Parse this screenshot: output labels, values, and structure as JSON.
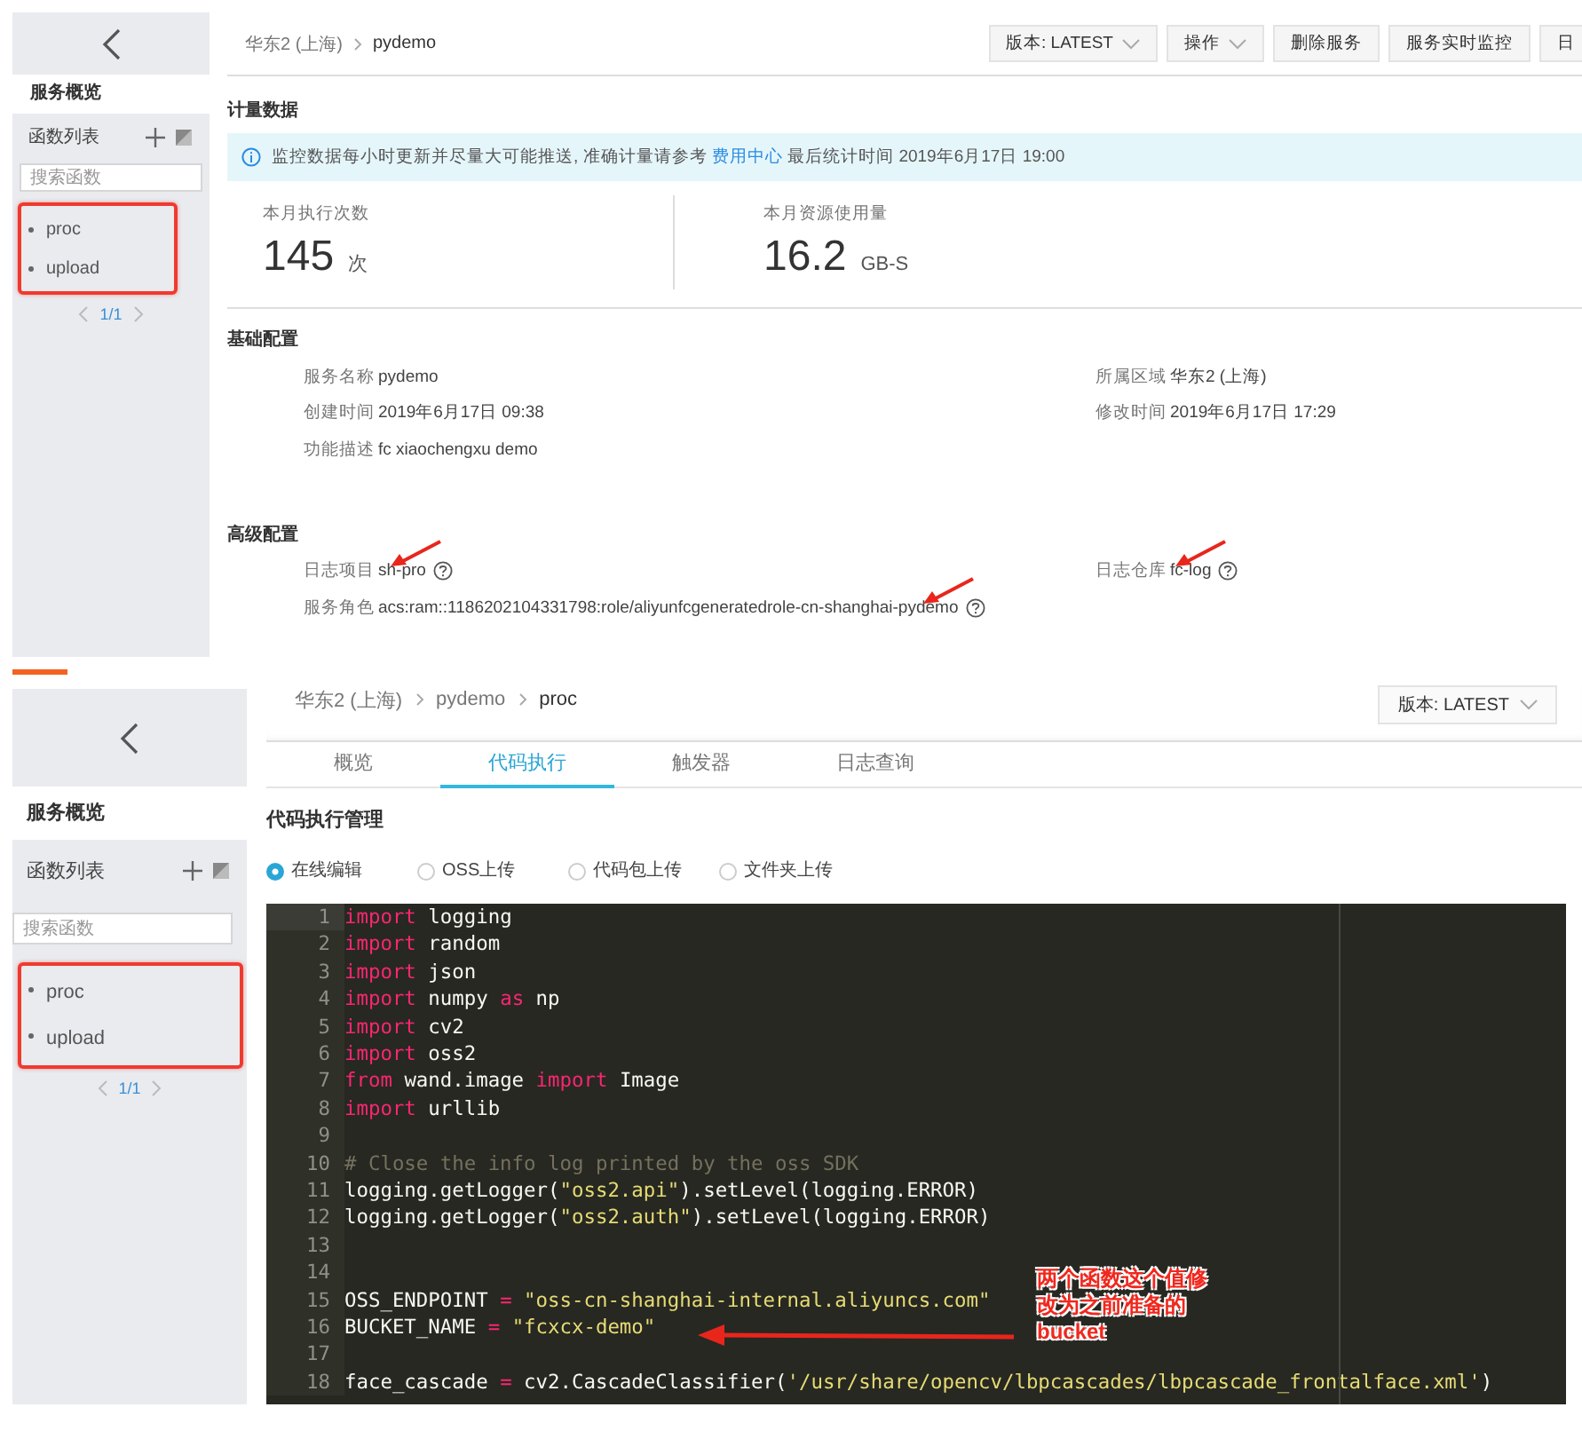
{
  "service_page": {
    "sidebar": {
      "title": "服务概览",
      "list_title": "函数列表",
      "search": {
        "placeholder": "搜索函数"
      },
      "highlighted": true,
      "functions": [
        {
          "name": "proc",
          "selected": false
        },
        {
          "name": "upload",
          "selected": false
        }
      ],
      "pagination": "1/1"
    },
    "breadcrumb": [
      "华东2 (上海)",
      "pydemo"
    ],
    "actions": [
      {
        "label": "版本: LATEST",
        "dropdown": true
      },
      {
        "label": "操作",
        "dropdown": true
      },
      {
        "label": "删除服务",
        "dropdown": false
      },
      {
        "label": "服务实时监控",
        "dropdown": false
      },
      {
        "label": "日",
        "dropdown": false
      }
    ],
    "metering": {
      "title": "计量数据",
      "notice": {
        "text": "监控数据每小时更新并尽量大可能推送, 准确计量请参考",
        "link": "费用中心",
        "text_after": "最后统计时间 2019年6月17日 19:00"
      },
      "stats": [
        {
          "label": "本月执行次数",
          "value": "145",
          "unit": "次"
        },
        {
          "label": "本月资源使用量",
          "value": "16.2",
          "unit": "GB-S"
        }
      ]
    },
    "basic": {
      "title": "基础配置",
      "left": [
        {
          "label": "服务名称",
          "value": "pydemo",
          "help": false,
          "arrow": false
        },
        {
          "label": "创建时间",
          "value": "2019年6月17日 09:38",
          "help": false,
          "arrow": false
        },
        {
          "label": "功能描述",
          "value": "fc xiaochengxu demo",
          "help": false,
          "arrow": false
        }
      ],
      "right": [
        {
          "label": "所属区域",
          "value": "华东2 (上海)",
          "help": false,
          "arrow": false
        },
        {
          "label": "修改时间",
          "value": "2019年6月17日 17:29",
          "help": false,
          "arrow": false
        }
      ]
    },
    "advanced": {
      "title": "高级配置",
      "left": [
        {
          "label": "日志项目",
          "value": "sh-pro",
          "help": true,
          "arrow": true
        },
        {
          "label": "服务角色",
          "value": "acs:ram::1186202104331798:role/aliyunfcgeneratedrole-cn-shanghai-pydemo",
          "help": true,
          "arrow": true
        }
      ],
      "right": [
        {
          "label": "日志仓库",
          "value": "fc-log",
          "help": true,
          "arrow": true
        }
      ]
    }
  },
  "function_page": {
    "sidebar": {
      "title": "服务概览",
      "list_title": "函数列表",
      "search": {
        "placeholder": "搜索函数"
      },
      "highlighted": true,
      "functions": [
        {
          "name": "proc",
          "selected": false
        },
        {
          "name": "upload",
          "selected": false
        }
      ],
      "pagination": "1/1"
    },
    "breadcrumb": [
      "华东2 (上海)",
      "pydemo",
      "proc"
    ],
    "actions": [
      {
        "label": "版本: LATEST",
        "dropdown": true
      }
    ],
    "tabs": [
      {
        "label": "概览",
        "selected": false
      },
      {
        "label": "代码执行",
        "selected": true
      },
      {
        "label": "触发器",
        "selected": false
      },
      {
        "label": "日志查询",
        "selected": false
      }
    ],
    "section_title": "代码执行管理",
    "upload_options": [
      {
        "label": "在线编辑",
        "selected": true
      },
      {
        "label": "OSS上传",
        "selected": false
      },
      {
        "label": "代码包上传",
        "selected": false
      },
      {
        "label": "文件夹上传",
        "selected": false
      }
    ],
    "editor": {
      "lines": [
        {
          "number": "1",
          "tokens": [
            {
              "kind": "keyword",
              "text": "import"
            },
            {
              "kind": "plain",
              "text": " logging"
            }
          ]
        },
        {
          "number": "2",
          "tokens": [
            {
              "kind": "keyword",
              "text": "import"
            },
            {
              "kind": "plain",
              "text": " random"
            }
          ]
        },
        {
          "number": "3",
          "tokens": [
            {
              "kind": "keyword",
              "text": "import"
            },
            {
              "kind": "plain",
              "text": " json"
            }
          ]
        },
        {
          "number": "4",
          "tokens": [
            {
              "kind": "keyword",
              "text": "import"
            },
            {
              "kind": "plain",
              "text": " numpy "
            },
            {
              "kind": "keyword",
              "text": "as"
            },
            {
              "kind": "plain",
              "text": " np"
            }
          ]
        },
        {
          "number": "5",
          "tokens": [
            {
              "kind": "keyword",
              "text": "import"
            },
            {
              "kind": "plain",
              "text": " cv2"
            }
          ]
        },
        {
          "number": "6",
          "tokens": [
            {
              "kind": "keyword",
              "text": "import"
            },
            {
              "kind": "plain",
              "text": " oss2"
            }
          ]
        },
        {
          "number": "7",
          "tokens": [
            {
              "kind": "keyword",
              "text": "from"
            },
            {
              "kind": "plain",
              "text": " wand.image "
            },
            {
              "kind": "keyword",
              "text": "import"
            },
            {
              "kind": "plain",
              "text": " Image"
            }
          ]
        },
        {
          "number": "8",
          "tokens": [
            {
              "kind": "keyword",
              "text": "import"
            },
            {
              "kind": "plain",
              "text": " urllib"
            }
          ]
        },
        {
          "number": "9"
        },
        {
          "number": "10",
          "tokens": [
            {
              "kind": "comment",
              "text": "# Close the info log printed by the oss SDK"
            }
          ]
        },
        {
          "number": "11",
          "tokens": [
            {
              "kind": "plain",
              "text": "logging.getLogger("
            },
            {
              "kind": "string",
              "text": "\"oss2.api\""
            },
            {
              "kind": "plain",
              "text": ").setLevel(logging.ERROR)"
            }
          ]
        },
        {
          "number": "12",
          "tokens": [
            {
              "kind": "plain",
              "text": "logging.getLogger("
            },
            {
              "kind": "string",
              "text": "\"oss2.auth\""
            },
            {
              "kind": "plain",
              "text": ").setLevel(logging.ERROR)"
            }
          ]
        },
        {
          "number": "13"
        },
        {
          "number": "14"
        },
        {
          "number": "15",
          "tokens": [
            {
              "kind": "plain",
              "text": "OSS_ENDPOINT "
            },
            {
              "kind": "keyword",
              "text": "="
            },
            {
              "kind": "string",
              "text": " \"oss-cn-shanghai-internal.aliyuncs.com\""
            }
          ]
        },
        {
          "number": "16",
          "tokens": [
            {
              "kind": "plain",
              "text": "BUCKET_NAME "
            },
            {
              "kind": "keyword",
              "text": "="
            },
            {
              "kind": "string",
              "text": " \"fcxcx-demo\""
            }
          ]
        },
        {
          "number": "17"
        },
        {
          "number": "18",
          "tokens": [
            {
              "kind": "plain",
              "text": "face_cascade "
            },
            {
              "kind": "keyword",
              "text": "="
            },
            {
              "kind": "plain",
              "text": " cv2.CascadeClassifier("
            },
            {
              "kind": "string",
              "text": "'/usr/share/opencv/lbpcascades/lbpcascade_frontalface.xml'"
            },
            {
              "kind": "plain",
              "text": ")"
            }
          ]
        }
      ]
    },
    "note": {
      "text": "两个函数这个值修改为之前准备的bucket"
    }
  }
}
